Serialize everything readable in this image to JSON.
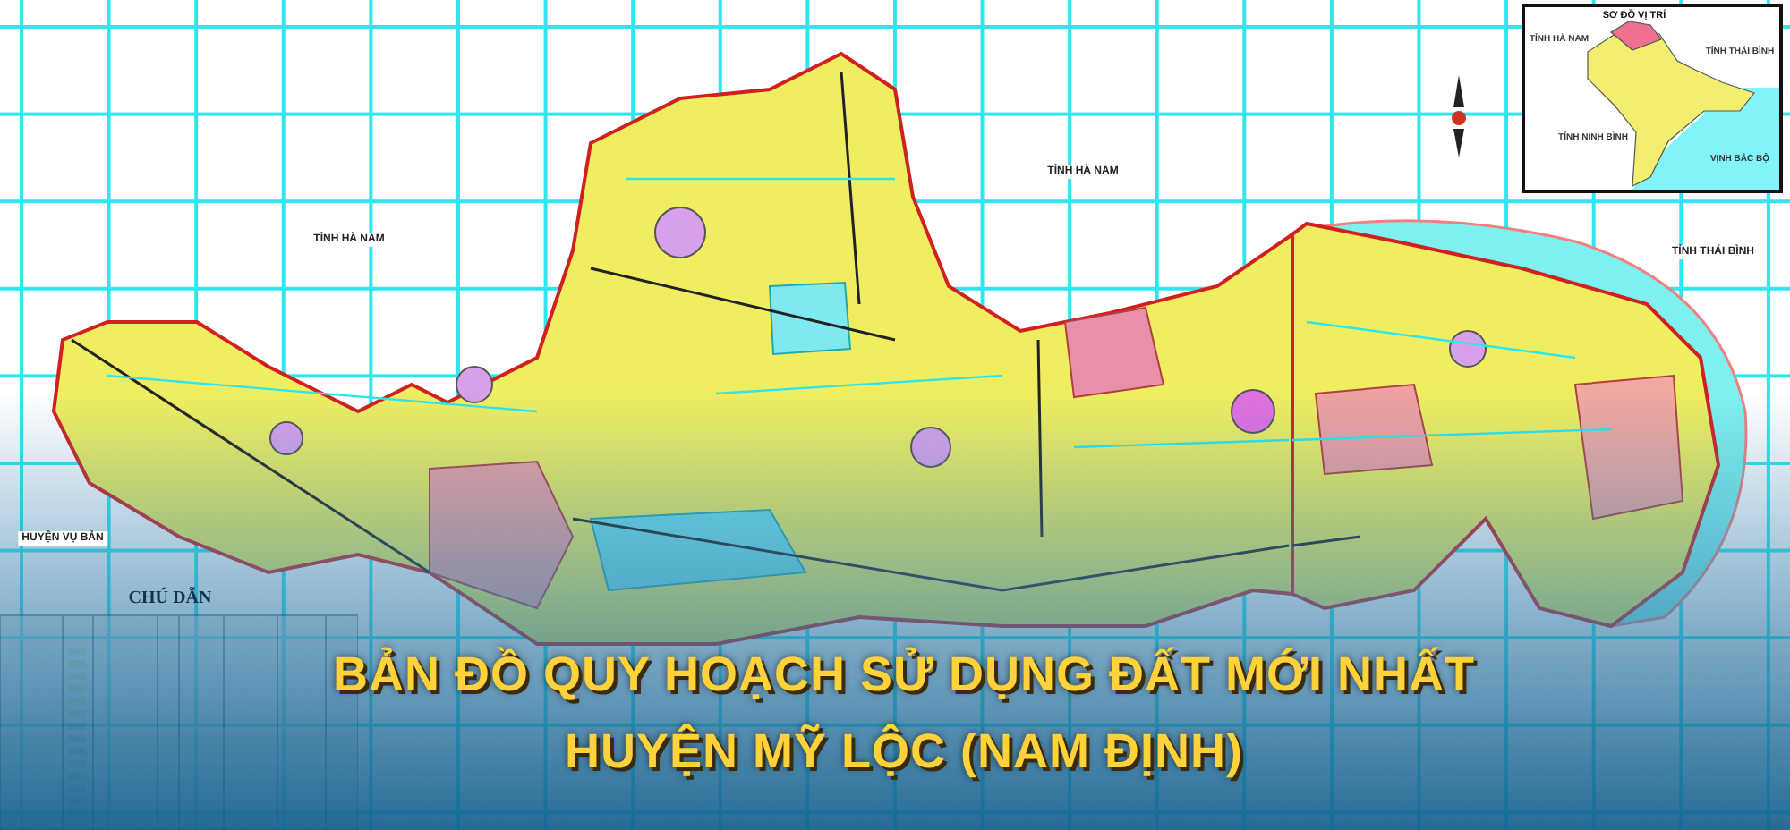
{
  "map_labels": [
    {
      "text": "TỈNH HÀ NAM"
    },
    {
      "text": "TỈNH HÀ NAM"
    },
    {
      "text": "TỈNH THÁI BÌNH"
    },
    {
      "text": "HUYỆN VỤ BẢN"
    }
  ],
  "inset": {
    "title": "SƠ ĐỒ VỊ TRÍ",
    "labels": [
      {
        "text": "TỈNH HÀ NAM"
      },
      {
        "text": "TỈNH THÁI BÌNH"
      },
      {
        "text": "TỈNH NINH BÌNH"
      },
      {
        "text": "VỊNH BẮC BỘ"
      }
    ]
  },
  "legend": {
    "title": "CHÚ DẪN"
  },
  "title": {
    "lines": [
      "BẢN ĐỒ QUY HOẠCH SỬ DỤNG ĐẤT MỚI NHẤT",
      "HUYỆN MỸ LỘC (NAM ĐỊNH)"
    ]
  }
}
